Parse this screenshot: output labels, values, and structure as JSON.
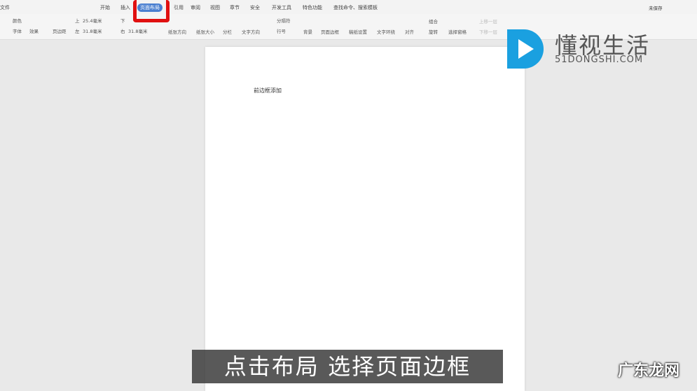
{
  "tabs": [
    "文件",
    "开始",
    "插入",
    "页面布局",
    "引用",
    "审阅",
    "视图",
    "章节",
    "安全",
    "开发工具",
    "特色功能"
  ],
  "search": "查找命令、搜索模板",
  "save_status": "未保存",
  "ribbon": {
    "color": "颜色",
    "font": "字体",
    "effect": "效果",
    "margins": "页边距",
    "top_label": "上",
    "top_val": "25.4毫米",
    "bottom_label": "下",
    "left_label": "左",
    "left_val": "31.8毫米",
    "right_label": "右",
    "right_val": "31.8毫米",
    "orientation": "纸张方向",
    "size": "纸张大小",
    "columns": "分栏",
    "text_dir": "文字方向",
    "breaks": "分隔符",
    "line_num": "行号",
    "background": "背景",
    "page_border": "页面边框",
    "draft": "稿纸设置",
    "wrap": "文字环绕",
    "align": "对齐",
    "group": "组合",
    "rotate": "旋转",
    "pane": "选择窗格",
    "up": "上移一层",
    "down": "下移一层"
  },
  "document": {
    "text": "前边框添加"
  },
  "subtitle": "点击布局 选择页面边框",
  "brand": {
    "name": "懂视生活",
    "site": "51DONGSHI.COM"
  },
  "watermark": "广东龙网"
}
